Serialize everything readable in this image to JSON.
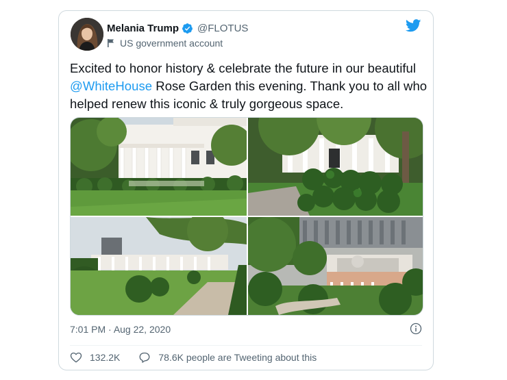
{
  "author": {
    "display_name": "Melania Trump",
    "handle": "@FLOTUS",
    "label": "US government account"
  },
  "tweet": {
    "text_before": "Excited to honor history & celebrate the future in our beautiful ",
    "mention": "@WhiteHouse",
    "text_after": " Rose Garden this evening. Thank you to all who helped renew this iconic & truly gorgeous space."
  },
  "media": {
    "count": 4
  },
  "meta": {
    "time": "7:01 PM",
    "separator": " · ",
    "date": "Aug 22, 2020"
  },
  "stats": {
    "likes": "132.2K",
    "replies": "78.6K people are Tweeting about this"
  },
  "colors": {
    "accent": "#1d9bf0",
    "text": "#0f1419",
    "secondary": "#536471",
    "border": "#cfd9de"
  },
  "icons": [
    "verified-badge-icon",
    "flag-icon",
    "twitter-logo-icon",
    "info-icon",
    "heart-icon",
    "reply-bubble-icon"
  ]
}
